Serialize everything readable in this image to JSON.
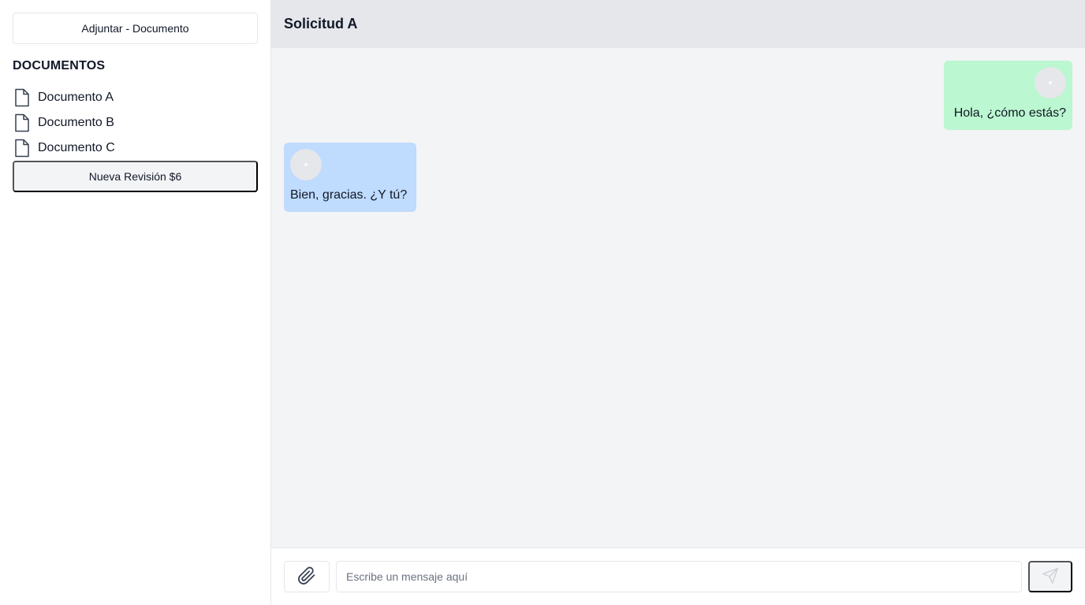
{
  "sidebar": {
    "attach_label": "Adjuntar - Documento",
    "heading": "DOCUMENTOS",
    "documents": [
      {
        "label": "Documento A",
        "icon": "file-icon"
      },
      {
        "label": "Documento B",
        "icon": "file-icon"
      },
      {
        "label": "Documento C",
        "icon": "file-icon"
      }
    ],
    "revision_label": "Nueva Revisión $6"
  },
  "chat": {
    "title": "Solicitud A",
    "messages": [
      {
        "direction": "outgoing",
        "text": "Hola, ¿cómo estás?",
        "bubble_color": "#bbf7d0"
      },
      {
        "direction": "incoming",
        "text": "Bien, gracias. ¿Y tú?",
        "bubble_color": "#bfdbfe"
      }
    ]
  },
  "composer": {
    "placeholder": "Escribe un mensaje aquí",
    "value": "",
    "attach_icon": "paperclip-icon",
    "send_icon": "send-icon"
  },
  "colors": {
    "header_bg": "#e5e7eb",
    "chat_bg": "#f3f4f6",
    "outgoing_bubble": "#bbf7d0",
    "incoming_bubble": "#bfdbfe"
  }
}
